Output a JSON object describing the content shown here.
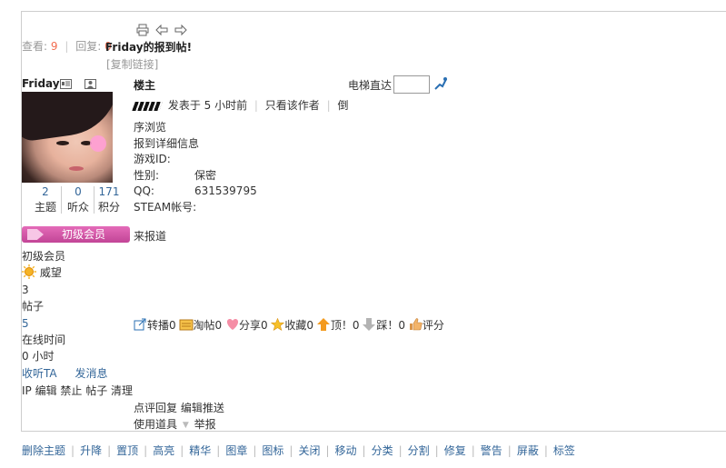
{
  "thread": {
    "views_label": "查看:",
    "views": "9",
    "replies_label": "回复:",
    "replies": "0",
    "title": "Friday的报到帖!",
    "copy_link": "[复制链接]"
  },
  "author": {
    "name": "Friday",
    "stats": [
      {
        "value": "2",
        "label": "主题"
      },
      {
        "value": "0",
        "label": "听众"
      },
      {
        "value": "171",
        "label": "积分"
      }
    ],
    "group": "初级会员",
    "group_name": "初级会员",
    "prestige_label": "威望",
    "prestige_value": "3",
    "posts_label": "帖子",
    "posts_value": "5",
    "online_label": "在线时间",
    "online_value": "0 小时",
    "follow": "收听TA",
    "message": "发消息",
    "admin_links": "IP 编辑 禁止 帖子 清理"
  },
  "post": {
    "floor": "楼主",
    "elevator_label": "电梯直达",
    "posted": "发表于 5 小时前",
    "only_author": "只看该作者",
    "reverse": "倒",
    "reverse_suffix": "序浏览",
    "body_lines": [
      {
        "key": "报到详细信息",
        "value": ""
      },
      {
        "key": "游戏ID:",
        "value": ""
      },
      {
        "key": "性别:",
        "value": "保密"
      },
      {
        "key": "QQ:",
        "value": "631539795"
      },
      {
        "key": "STEAM帐号:",
        "value": ""
      }
    ],
    "came_from": "来报道",
    "actions": [
      {
        "icon": "share-icon",
        "label": "转播0"
      },
      {
        "icon": "tao-icon",
        "label": "淘帖0"
      },
      {
        "icon": "heart-icon",
        "label": "分享0"
      },
      {
        "icon": "star-icon",
        "label": "收藏0"
      },
      {
        "icon": "up-arrow-icon",
        "label": "顶！0"
      },
      {
        "icon": "down-arrow-icon",
        "label": "踩！0"
      },
      {
        "icon": "thumb-icon",
        "label": "评分"
      }
    ],
    "comment_reply": "点评回复",
    "edit_push": "编辑推送",
    "use_tool": "使用道具",
    "report": "举报"
  },
  "moderation": [
    "删除主题",
    "升降",
    "置顶",
    "高亮",
    "精华",
    "图章",
    "图标",
    "关闭",
    "移动",
    "分类",
    "分割",
    "修复",
    "警告",
    "屏蔽",
    "标签"
  ],
  "colors": {
    "link": "#336699",
    "accent": "#f26c4f",
    "badge": "#d657a8"
  }
}
